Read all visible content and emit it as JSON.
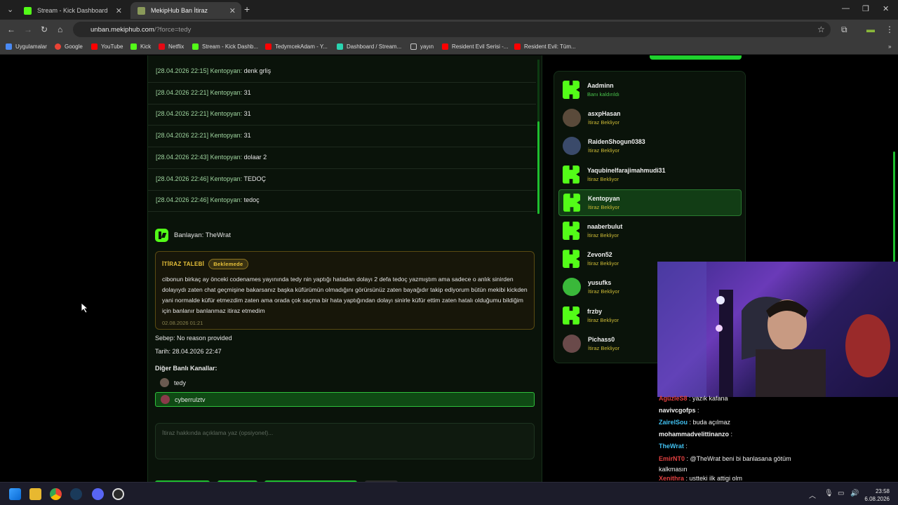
{
  "browser": {
    "tabs": [
      {
        "title": "Stream - Kick Dashboard",
        "color": "#53fc18"
      },
      {
        "title": "MekipHub Ban İtiraz",
        "color": "#8a9a5a"
      }
    ],
    "url_host": "unban.mekiphub.com",
    "url_path": "/?force=tedy",
    "bookmarks": [
      {
        "label": "Uygulamalar",
        "color": "#4a8af4"
      },
      {
        "label": "Google",
        "color": "#ea4335"
      },
      {
        "label": "YouTube",
        "color": "#ff0000"
      },
      {
        "label": "Kick",
        "color": "#53fc18"
      },
      {
        "label": "Netflix",
        "color": "#e50914"
      },
      {
        "label": "Stream - Kick Dashb...",
        "color": "#53fc18"
      },
      {
        "label": "TedymcekAdam - Y...",
        "color": "#ff0000"
      },
      {
        "label": "Dashboard / Stream...",
        "color": "#2ad4b0"
      },
      {
        "label": "yayın",
        "color": "#c8c8c8"
      },
      {
        "label": "Resident Evil Serisi -...",
        "color": "#ff0000"
      },
      {
        "label": "Resident Evil: Tüm...",
        "color": "#ff0000"
      }
    ]
  },
  "log": [
    {
      "ts": "[28.04.2026 22:15]",
      "user": "Kentopyan:",
      "msg": "denk grliş"
    },
    {
      "ts": "[28.04.2026 22:21]",
      "user": "Kentopyan:",
      "msg": "31"
    },
    {
      "ts": "[28.04.2026 22:21]",
      "user": "Kentopyan:",
      "msg": "31"
    },
    {
      "ts": "[28.04.2026 22:21]",
      "user": "Kentopyan:",
      "msg": "31"
    },
    {
      "ts": "[28.04.2026 22:43]",
      "user": "Kentopyan:",
      "msg": "dolaar 2"
    },
    {
      "ts": "[28.04.2026 22:46]",
      "user": "Kentopyan:",
      "msg": "TEDOÇ"
    },
    {
      "ts": "[28.04.2026 22:46]",
      "user": "Kentopyan:",
      "msg": "tedoç"
    }
  ],
  "banned_by": "Banlayan: TheWrat",
  "appeal": {
    "heading": "İTİRAZ TALEBİ",
    "status": "Beklemede",
    "text": "cibonun birkaç ay önceki codenames yayınında tedy nin yaptığı hatadan dolayı 2 defa tedoç yazmıştım ama sadece o anlık sinirden dolayıydı zaten chat geçmişine bakarsanız başka küfürümün olmadığını görürsünüz zaten bayağıdır takip ediyorum bütün mekibi kickden yani normalde küfür etmezdim zaten ama orada çok saçma bir hata yaptığından dolayı sinirle küfür ettim zaten hatalı olduğumu bildiğim için banlanır banlanmaz itiraz etmedim",
    "timestamp": "02.08.2026 01:21"
  },
  "reason": "Sebep: No reason provided",
  "date": "Tarih: 28.04.2026 22:47",
  "other_channels_label": "Diğer Banlı Kanallar:",
  "other_channels": [
    "tedy",
    "cyberrulztv"
  ],
  "comment_placeholder": "İtiraz hakkında açıklama yaz (opsiyonel)...",
  "users": [
    {
      "name": "Aadminn",
      "status": "Banı kaldırıldı",
      "avatar": "kick"
    },
    {
      "name": "asxpHasan",
      "status": "İtiraz Bekliyor",
      "avatar": "#5a4a3a"
    },
    {
      "name": "RaidenShogun0383",
      "status": "İtiraz Bekliyor",
      "avatar": "#3a4a6a"
    },
    {
      "name": "Yaqubinelfarajimahmudi31",
      "status": "İtiraz Bekliyor",
      "avatar": "kick"
    },
    {
      "name": "Kentopyan",
      "status": "İtiraz Bekliyor",
      "avatar": "kick"
    },
    {
      "name": "naaberbulut",
      "status": "İtiraz Bekliyor",
      "avatar": "kick"
    },
    {
      "name": "Zevon52",
      "status": "İtiraz Bekliyor",
      "avatar": "kick"
    },
    {
      "name": "yusufks",
      "status": "İtiraz Bekliyor",
      "avatar": "#3ab83a"
    },
    {
      "name": "frzby",
      "status": "İtiraz Bekliyor",
      "avatar": "kick"
    },
    {
      "name": "Pichass0",
      "status": "İtiraz Bekliyor",
      "avatar": "#6a4a4a"
    }
  ],
  "chat": [
    {
      "user": "AgüzleS8",
      "msg": ": yazık kafana",
      "color": "#e04040"
    },
    {
      "user": "navivcgofps",
      "msg": ":",
      "color": "#f0f0f0"
    },
    {
      "user": "ZairelSou",
      "msg": ": buda açılmaz",
      "color": "#40c0f0"
    },
    {
      "user": "mohammadvelittinanzo",
      "msg": ":",
      "color": "#f0f0f0"
    },
    {
      "user": "TheWrat",
      "msg": ":",
      "color": "#40c0f0"
    },
    {
      "user": "EmirNT0",
      "msg": ": @TheWrat beni bi banlasana götüm kalkmasın",
      "color": "#e04040"
    },
    {
      "user": "Xenithra",
      "msg": ": ustteki ilk attigi olm",
      "color": "#e04040"
    }
  ],
  "clock": {
    "time": "23:58",
    "date": "6.08.2026"
  }
}
